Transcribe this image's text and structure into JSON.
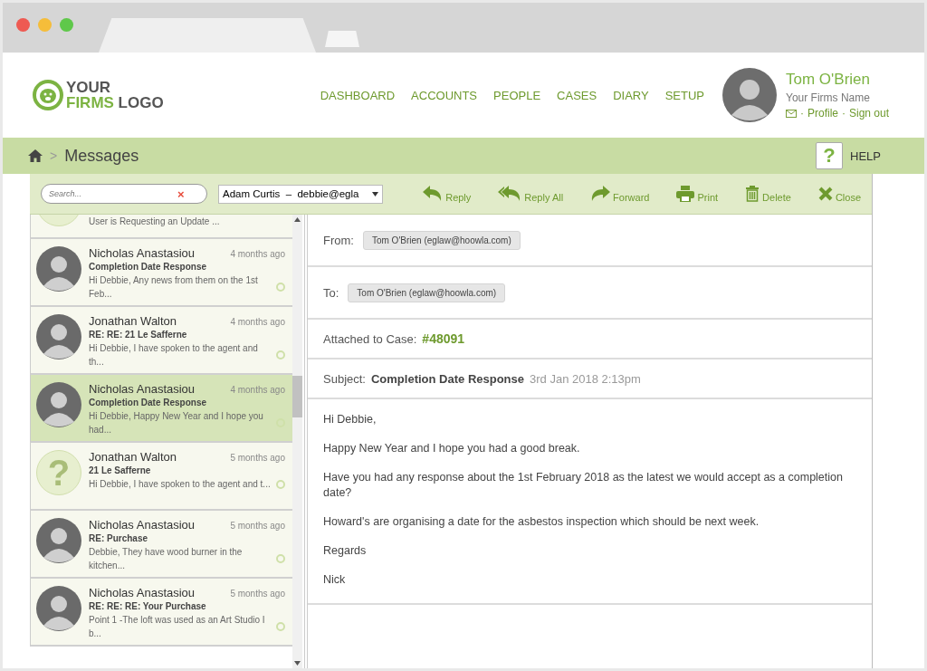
{
  "logo": {
    "line1": "YOUR",
    "line2_accent": "FIRMS",
    "line2_rest": "LOGO"
  },
  "nav": [
    {
      "label": "DASHBOARD",
      "selected": false
    },
    {
      "label": "ACCOUNTS",
      "selected": false
    },
    {
      "label": "PEOPLE",
      "selected": false
    },
    {
      "label": "CASES",
      "selected": false
    },
    {
      "label": "DIARY",
      "selected": false
    },
    {
      "label": "SETUP",
      "selected": false
    }
  ],
  "user": {
    "name": "Tom O'Brien",
    "firm": "Your Firms Name",
    "separator": "·",
    "links": [
      "Profile",
      "Sign out"
    ]
  },
  "breadcrumb": {
    "separator": ">",
    "current": "Messages"
  },
  "help": {
    "icon": "?",
    "label": "HELP"
  },
  "toolbar": {
    "search_placeholder": "Search...",
    "clear": "×",
    "mailbox": "Adam Curtis  –  debbie@egla",
    "actions": [
      {
        "kind": "reply",
        "label": "Reply"
      },
      {
        "kind": "reply_all",
        "label": "Reply All"
      },
      {
        "kind": "forward",
        "label": "Forward"
      },
      {
        "kind": "print",
        "label": "Print"
      },
      {
        "kind": "delete",
        "label": "Delete"
      },
      {
        "kind": "close",
        "label": "Close"
      }
    ]
  },
  "messages": [
    {
      "partial": true,
      "kind": "unknown",
      "preview": "User is Requesting an Update ...",
      "selected": false
    },
    {
      "kind": "photo",
      "sender": "Nicholas Anastasiou",
      "time": "4 months ago",
      "subject": "Completion Date Response",
      "preview": "Hi Debbie, Any news from them on the 1st Feb...",
      "selected": false
    },
    {
      "kind": "photo",
      "sender": "Jonathan Walton",
      "time": "4 months ago",
      "subject": "RE: RE: 21 Le Safferne",
      "preview": "Hi Debbie, I have spoken to the agent and th...",
      "selected": false
    },
    {
      "kind": "photo",
      "sender": "Nicholas Anastasiou",
      "time": "4 months ago",
      "subject": "Completion Date Response",
      "preview": "Hi Debbie, Happy New Year and I hope you had...",
      "selected": true
    },
    {
      "kind": "unknown",
      "unknown_mark": "?",
      "sender": "Jonathan Walton",
      "time": "5 months ago",
      "subject": "21 Le Safferne",
      "preview": "Hi Debbie, I have spoken to the agent and t...",
      "selected": false
    },
    {
      "kind": "photo",
      "sender": "Nicholas Anastasiou",
      "time": "5 months ago",
      "subject": "RE: Purchase",
      "preview": "Debbie, They have wood burner in the kitchen...",
      "selected": false
    },
    {
      "kind": "photo",
      "sender": "Nicholas Anastasiou",
      "time": "5 months ago",
      "subject": "RE: RE: RE: Your Purchase",
      "preview": "Point 1 -The loft was used as an Art Studio I b...",
      "selected": false
    }
  ],
  "email": {
    "from_label": "From:",
    "from": "Tom O'Brien (eglaw@hoowla.com)",
    "to_label": "To:",
    "to": "Tom O'Brien (eglaw@hoowla.com)",
    "case_label": "Attached to Case:",
    "case": "#48091",
    "subject_label": "Subject:",
    "subject": "Completion Date Response",
    "date": "3rd Jan 2018 2:13pm",
    "body": [
      "Hi Debbie,",
      "Happy New Year and I hope you had a good break.",
      "Have you had any response about the 1st February 2018 as the latest we would accept as a completion date?",
      "Howard's are organising a date for the asbestos inspection which should be next week.",
      "Regards",
      "Nick"
    ]
  }
}
